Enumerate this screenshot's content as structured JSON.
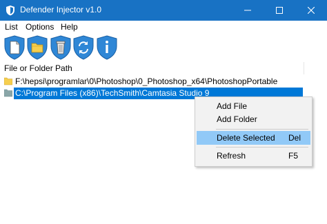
{
  "window": {
    "title": "Defender Injector v1.0"
  },
  "colors": {
    "titlebar": "#1872c4",
    "selection": "#0078d7",
    "menu_highlight": "#91c9f7",
    "shield": "#2f87d6"
  },
  "menubar": {
    "items": [
      "List",
      "Options",
      "Help"
    ]
  },
  "toolbar": {
    "buttons": [
      "add-file",
      "add-folder",
      "delete",
      "refresh",
      "info"
    ]
  },
  "list": {
    "header": "File or Folder Path",
    "rows": [
      "F:\\hepsi\\programlar\\0\\Photoshop\\0_Photoshop_x64\\PhotoshopPortable",
      "C:\\Program Files (x86)\\TechSmith\\Camtasia Studio 9"
    ]
  },
  "context_menu": {
    "items": [
      {
        "label": "Add File",
        "shortcut": ""
      },
      {
        "label": "Add Folder",
        "shortcut": ""
      },
      {
        "label": "Delete Selected",
        "shortcut": "Del"
      },
      {
        "label": "Refresh",
        "shortcut": "F5"
      }
    ]
  }
}
